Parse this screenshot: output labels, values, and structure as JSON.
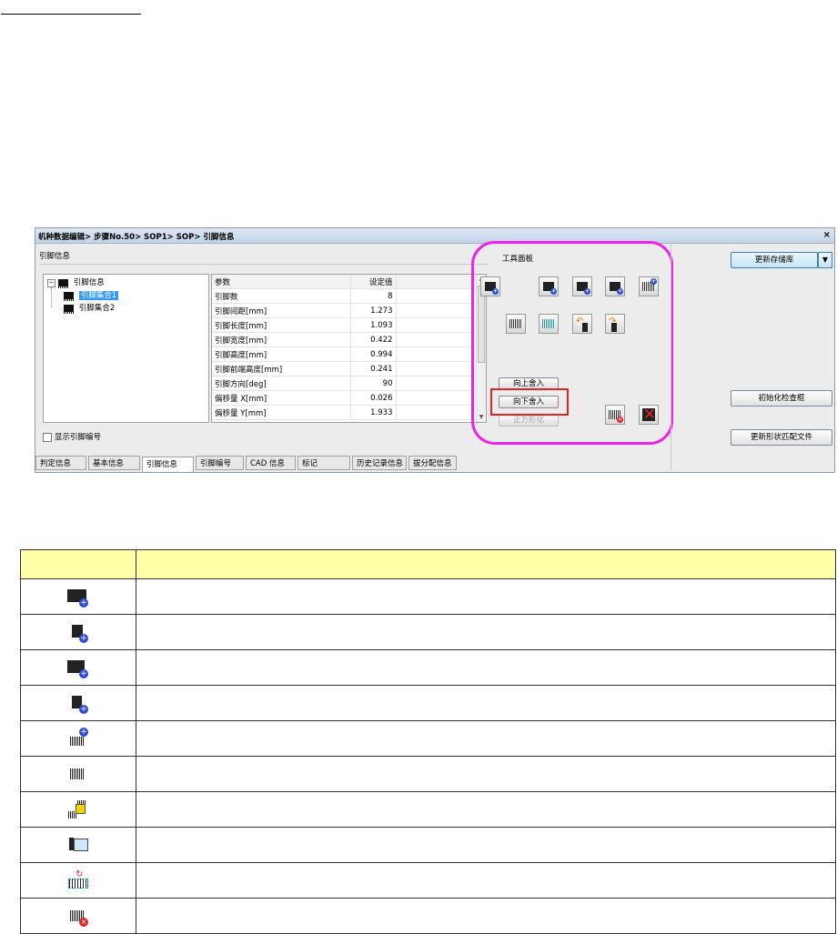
{
  "window": {
    "title": "机种数据编辑> 步骤No.50> SOP1> SOP> 引脚信息",
    "close": "×"
  },
  "left": {
    "section_label": "引脚信息",
    "tree": {
      "root": "引脚信息",
      "items": [
        "引脚集合1",
        "引脚集合2"
      ],
      "selected": "引脚集合1"
    },
    "grid": {
      "headers": [
        "参数",
        "设定值"
      ],
      "rows": [
        {
          "param": "引脚数",
          "value": "8"
        },
        {
          "param": "引脚间距[mm]",
          "value": "1.273"
        },
        {
          "param": "引脚长度[mm]",
          "value": "1.093"
        },
        {
          "param": "引脚宽度[mm]",
          "value": "0.422"
        },
        {
          "param": "引脚高度[mm]",
          "value": "0.994"
        },
        {
          "param": "引脚前端高度[mm]",
          "value": "0.241"
        },
        {
          "param": "引脚方向[deg]",
          "value": "90"
        },
        {
          "param": "偏移量 X[mm]",
          "value": "0.026"
        },
        {
          "param": "偏移量 Y[mm]",
          "value": "1.933"
        }
      ]
    },
    "checkbox_label": "显示引脚编号",
    "tabs": [
      "判定信息",
      "基本信息",
      "引脚信息",
      "引脚编号",
      "CAD 信息",
      "标记",
      "历史记录信息",
      "拔分配信息"
    ],
    "active_tab": "引脚信息"
  },
  "tool_panel": {
    "label": "工具面板",
    "buttons": {
      "round_up": "向上舍入",
      "round_down": "向下舍入",
      "normalize": "正方形化"
    }
  },
  "right": {
    "update_library": "更新存储库",
    "init_check": "初始化检查框",
    "update_shape": "更新形状匹配文件"
  },
  "legend": {
    "rows": 10
  },
  "colors": {
    "highlight_ring": "#ee22ee",
    "highlight_box": "#e0242a",
    "legend_header": "#ffffa8",
    "selection": "#3399ff"
  }
}
